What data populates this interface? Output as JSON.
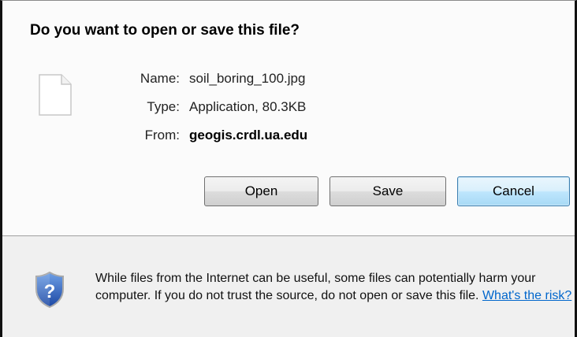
{
  "dialog": {
    "question": "Do you want to open or save this file?",
    "file_icon": "generic-file-icon",
    "details": {
      "name_label": "Name:",
      "name_value": "soil_boring_100.jpg",
      "type_label": "Type:",
      "type_value": "Application, 80.3KB",
      "from_label": "From:",
      "from_value": "geogis.crdl.ua.edu"
    },
    "buttons": {
      "open": "Open",
      "save": "Save",
      "cancel": "Cancel"
    },
    "warning": {
      "icon": "security-shield-question-icon",
      "text": "While files from the Internet can be useful, some files can potentially harm your computer. If you do not trust the source, do not open or save this file.",
      "link": "What's the risk?"
    }
  },
  "colors": {
    "top_background": "#fbfbfb",
    "bottom_background": "#f0f0f0",
    "link": "#0066cc",
    "shield": "#2a5fb8"
  }
}
